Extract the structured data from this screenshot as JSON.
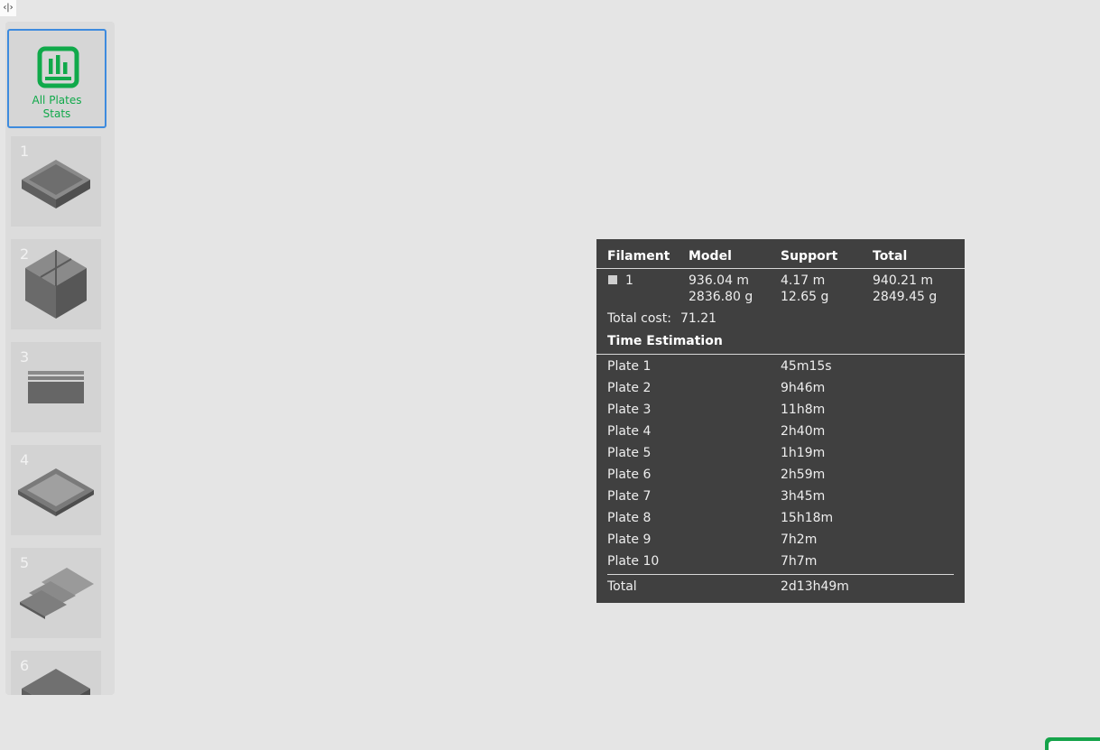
{
  "sidebar": {
    "collapse_glyph": "‹|›",
    "stats_card": {
      "label_line1": "All Plates",
      "label_line2": "Stats",
      "icon": "bar-chart-icon",
      "accent": "#10a94a"
    },
    "plates": [
      {
        "number": "1"
      },
      {
        "number": "2"
      },
      {
        "number": "3"
      },
      {
        "number": "4"
      },
      {
        "number": "5"
      },
      {
        "number": "6"
      }
    ]
  },
  "stats": {
    "headers": {
      "filament": "Filament",
      "model": "Model",
      "support": "Support",
      "total": "Total"
    },
    "filament": {
      "id": "1",
      "model_length": "936.04 m",
      "model_weight": "2836.80 g",
      "support_length": "4.17 m",
      "support_weight": "12.65 g",
      "total_length": "940.21 m",
      "total_weight": "2849.45 g"
    },
    "cost_label": "Total cost:",
    "cost_value": "71.21",
    "time_title": "Time Estimation",
    "plates": [
      {
        "name": "Plate 1",
        "time": "45m15s"
      },
      {
        "name": "Plate 2",
        "time": "9h46m"
      },
      {
        "name": "Plate 3",
        "time": "11h8m"
      },
      {
        "name": "Plate 4",
        "time": "2h40m"
      },
      {
        "name": "Plate 5",
        "time": "1h19m"
      },
      {
        "name": "Plate 6",
        "time": "2h59m"
      },
      {
        "name": "Plate 7",
        "time": "3h45m"
      },
      {
        "name": "Plate 8",
        "time": "15h18m"
      },
      {
        "name": "Plate 9",
        "time": "7h2m"
      },
      {
        "name": "Plate 10",
        "time": "7h7m"
      }
    ],
    "total_label": "Total",
    "total_time": "2d13h49m"
  }
}
